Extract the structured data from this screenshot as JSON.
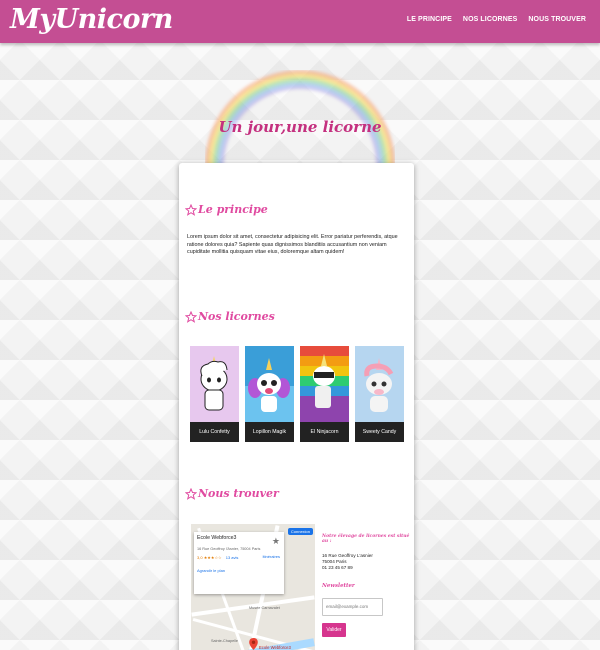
{
  "header": {
    "logo": "MyUnicorn",
    "nav": [
      "LE PRINCIPE",
      "NOS LICORNES",
      "NOUS TROUVER"
    ]
  },
  "hero": {
    "title": "Un jour,une licorne"
  },
  "principe": {
    "title": "Le principe",
    "text": "Lorem ipsum dolor sit amet, consectetur adipisicing elit. Error pariatur perferendis, atque ratione dolores quia? Sapiente quas dignissimos blanditiis accusantium non veniam cupiditate mollitia quisquam vitae eius, doloremque altam quidem!"
  },
  "licornes": {
    "title": "Nos licornes",
    "items": [
      {
        "name": "Lulu Confetty"
      },
      {
        "name": "Lopillon Magik"
      },
      {
        "name": "El Ninjacorn"
      },
      {
        "name": "Sweety Candy"
      }
    ]
  },
  "trouver": {
    "title": "Nous trouver",
    "map": {
      "place_name": "Ecole Webforce3",
      "place_address": "16 Rue Geoffroy l'Asnier, 75004 Paris",
      "rating": "3,0",
      "stars": "★★★☆☆",
      "reviews": "13 avis",
      "directions": "Itinéraires",
      "larger_map": "Agrandir le plan",
      "connect_label": "Connexion",
      "pin_label": "Ecole Webforce3",
      "label_museum": "Musée Carnavalet",
      "label_chapelle": "Sainte-Chapelle"
    },
    "question": "Notre élevage de licornes est situé au :",
    "address_lines": [
      "16 Rue Geoffroy L'asnier",
      "75004 Paris",
      "01 23 45 67 89"
    ],
    "newsletter_title": "Newsletter",
    "email_placeholder": "email@example.com",
    "submit_label": "Valider"
  },
  "colors": {
    "header": "#c44e93",
    "accent": "#e04aa0",
    "button": "#d6358e"
  }
}
